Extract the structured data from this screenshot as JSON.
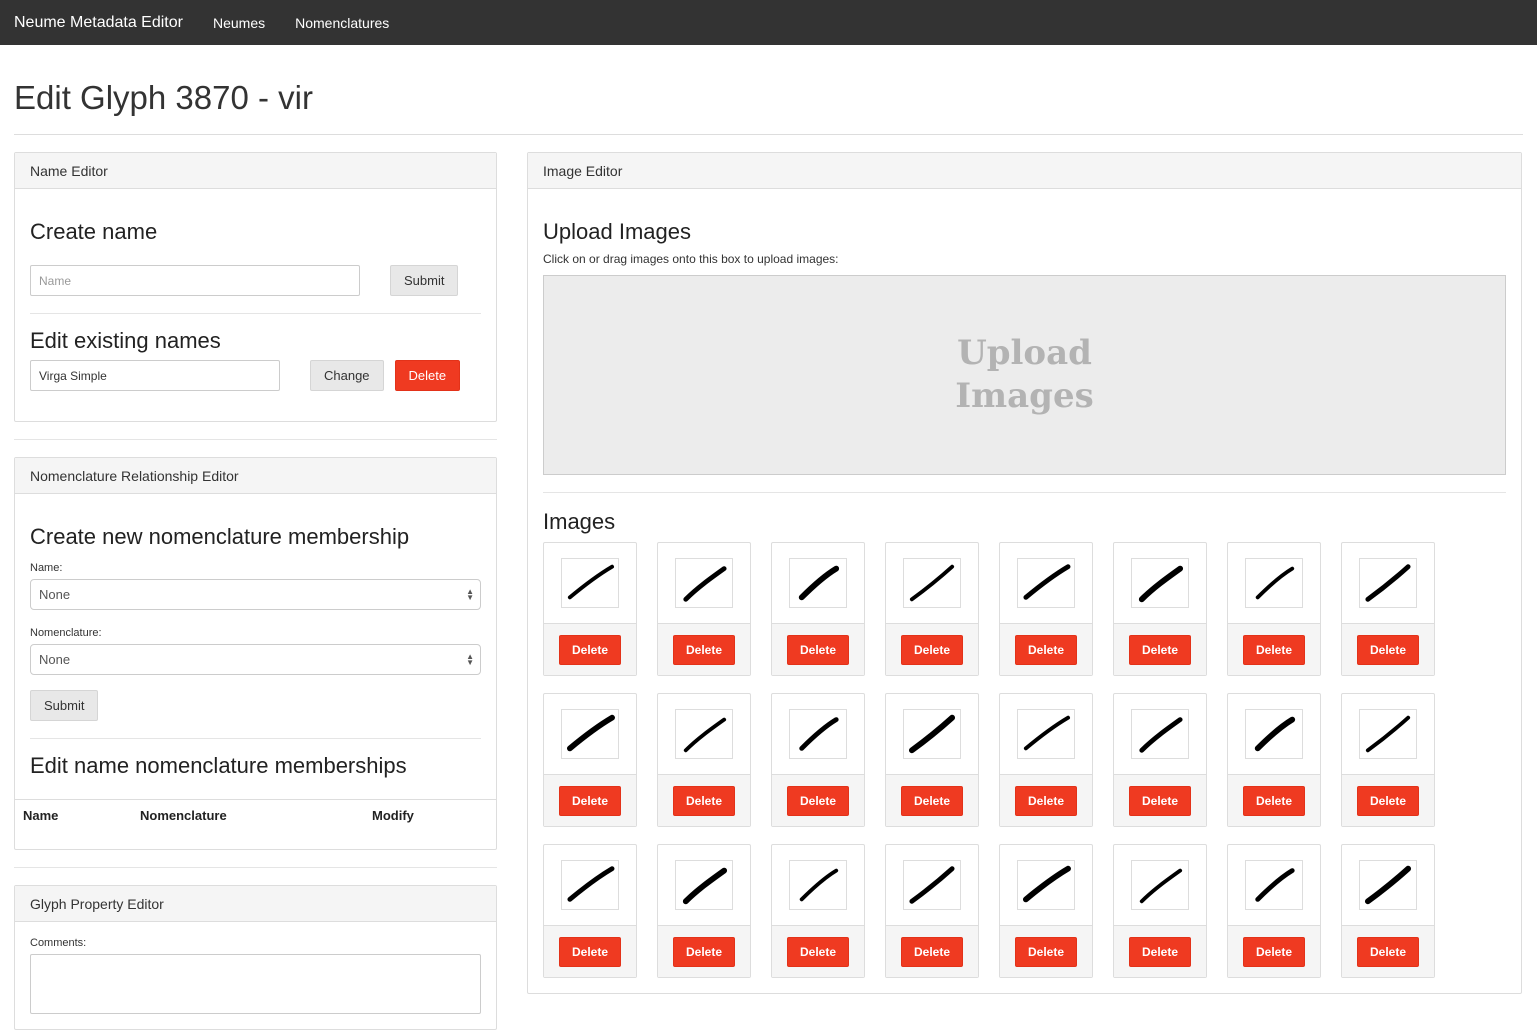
{
  "navbar": {
    "brand": "Neume Metadata Editor",
    "links": [
      "Neumes",
      "Nomenclatures"
    ]
  },
  "page_title": "Edit Glyph 3870 - vir",
  "name_editor": {
    "heading": "Name Editor",
    "create_title": "Create name",
    "name_placeholder": "Name",
    "submit_label": "Submit",
    "edit_title": "Edit existing names",
    "existing_name": "Virga Simple",
    "change_label": "Change",
    "delete_label": "Delete"
  },
  "nomenclature_editor": {
    "heading": "Nomenclature Relationship Editor",
    "create_title": "Create new nomenclature membership",
    "name_label": "Name:",
    "name_value": "None",
    "nomenclature_label": "Nomenclature:",
    "nomenclature_value": "None",
    "submit_label": "Submit",
    "edit_title": "Edit name nomenclature memberships",
    "columns": [
      "Name",
      "Nomenclature",
      "Modify"
    ]
  },
  "property_editor": {
    "heading": "Glyph Property Editor",
    "comments_label": "Comments:"
  },
  "image_editor": {
    "heading": "Image Editor",
    "upload_title": "Upload Images",
    "upload_hint": "Click on or drag images onto this box to upload images:",
    "dropzone_text": "Upload Images",
    "images_title": "Images",
    "delete_label": "Delete",
    "image_count": 24
  },
  "colors": {
    "navbar": "#333333",
    "danger": "#ef3a21",
    "panel_heading": "#f5f5f5",
    "dropzone": "#ececec"
  }
}
